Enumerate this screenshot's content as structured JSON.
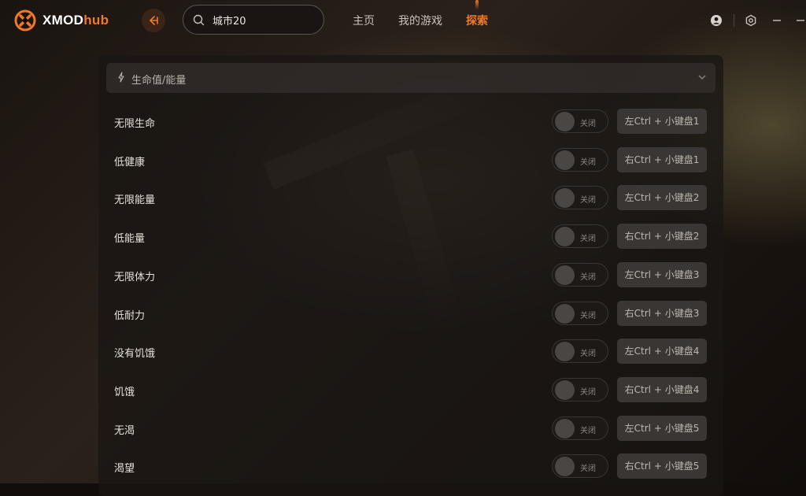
{
  "app": {
    "logo_text_main": "XMOD",
    "logo_text_accent": "hub",
    "accent_color": "#f07a2a"
  },
  "search": {
    "value": "城市20"
  },
  "nav": {
    "home": "主页",
    "my_games": "我的游戏",
    "explore": "探索",
    "active": "explore"
  },
  "section": {
    "title": "生命值/能量"
  },
  "cheats": [
    {
      "label": "无限生命",
      "toggle": "关闭",
      "hotkey": "左Ctrl + 小键盘1"
    },
    {
      "label": "低健康",
      "toggle": "关闭",
      "hotkey": "右Ctrl + 小键盘1"
    },
    {
      "label": "无限能量",
      "toggle": "关闭",
      "hotkey": "左Ctrl + 小键盘2"
    },
    {
      "label": "低能量",
      "toggle": "关闭",
      "hotkey": "右Ctrl + 小键盘2"
    },
    {
      "label": "无限体力",
      "toggle": "关闭",
      "hotkey": "左Ctrl + 小键盘3"
    },
    {
      "label": "低耐力",
      "toggle": "关闭",
      "hotkey": "右Ctrl + 小键盘3"
    },
    {
      "label": "没有饥饿",
      "toggle": "关闭",
      "hotkey": "左Ctrl + 小键盘4"
    },
    {
      "label": "饥饿",
      "toggle": "关闭",
      "hotkey": "右Ctrl + 小键盘4"
    },
    {
      "label": "无渴",
      "toggle": "关闭",
      "hotkey": "左Ctrl + 小键盘5"
    },
    {
      "label": "渴望",
      "toggle": "关闭",
      "hotkey": "右Ctrl + 小键盘5"
    }
  ]
}
